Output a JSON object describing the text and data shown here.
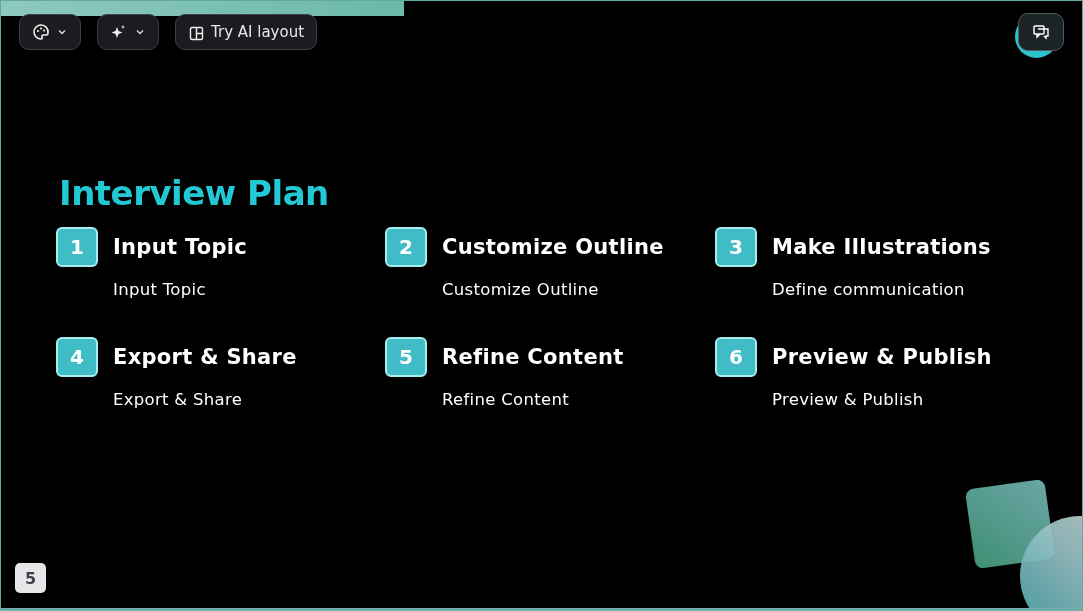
{
  "progress": {
    "level": 0.373
  },
  "toolbar": {
    "ai_layout_button": "Try AI layout"
  },
  "slide": {
    "title": "Interview Plan",
    "steps": [
      {
        "number": "1",
        "title": "Input Topic",
        "description": "Input Topic"
      },
      {
        "number": "2",
        "title": "Customize Outline",
        "description": "Customize Outline"
      },
      {
        "number": "3",
        "title": "Make Illustrations",
        "description": "Define communication"
      },
      {
        "number": "4",
        "title": "Export & Share",
        "description": "Export & Share"
      },
      {
        "number": "5",
        "title": "Refine Content",
        "description": "Refine Content"
      },
      {
        "number": "6",
        "title": "Preview & Publish",
        "description": "Preview & Publish"
      }
    ]
  },
  "page_number": "5"
}
